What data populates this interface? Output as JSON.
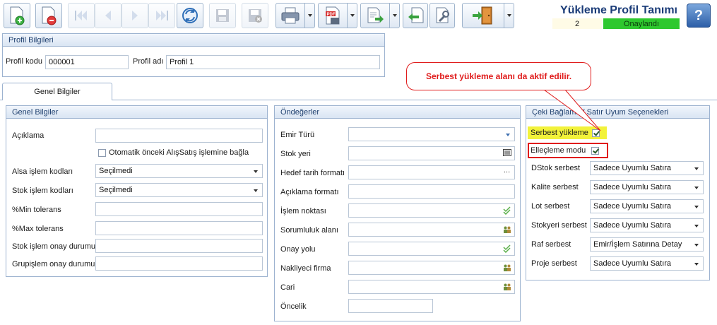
{
  "header": {
    "title": "Yükleme Profil Tanımı",
    "record_count": "2",
    "status": "Onaylandı"
  },
  "profile_info": {
    "title": "Profil Bilgileri",
    "code_label": "Profil kodu",
    "code_value": "000001",
    "name_label": "Profil adı",
    "name_value": "Profil 1"
  },
  "tabs": [
    {
      "label": "Genel Bilgiler"
    }
  ],
  "callout": {
    "text": "Serbest yükleme alanı da aktif edilir."
  },
  "general": {
    "title": "Genel Bilgiler",
    "description_label": "Açıklama",
    "description_value": "",
    "auto_link_label": "Otomatik önceki AlışSatış işlemine bağla",
    "buy_codes_label": "Alsa işlem kodları",
    "buy_codes_value": "Seçilmedi",
    "stock_codes_label": "Stok işlem kodları",
    "stock_codes_value": "Seçilmedi",
    "min_tol_label": "%Min tolerans",
    "min_tol_value": "",
    "max_tol_label": "%Max tolerans",
    "max_tol_value": "",
    "stock_approval_label": "Stok işlem onay durumu",
    "stock_approval_value": "",
    "group_approval_label": "Grupişlem onay durumu",
    "group_approval_value": ""
  },
  "defaults": {
    "title": "Öndeğerler",
    "order_type_label": "Emir Türü",
    "stock_place_label": "Stok yeri",
    "target_date_label": "Hedef tarih formatı",
    "desc_format_label": "Açıklama formatı",
    "process_point_label": "İşlem noktası",
    "resp_area_label": "Sorumluluk alanı",
    "approval_path_label": "Onay yolu",
    "carrier_label": "Nakliyeci firma",
    "account_label": "Cari",
    "priority_label": "Öncelik"
  },
  "options": {
    "title": "Çeki Bağlama / Satır Uyum Seçenekleri",
    "free_load_label": "Serbest yükleme",
    "free_load_checked": true,
    "handling_mode_label": "Elleçleme modu",
    "handling_mode_checked": true,
    "rows": [
      {
        "label": "DStok serbest",
        "value": "Sadece Uyumlu Satıra"
      },
      {
        "label": "Kalite serbest",
        "value": "Sadece Uyumlu Satıra"
      },
      {
        "label": "Lot serbest",
        "value": "Sadece Uyumlu Satıra"
      },
      {
        "label": "Stokyeri serbest",
        "value": "Sadece Uyumlu Satıra"
      },
      {
        "label": "Raf serbest",
        "value": "Emir/İşlem Satırına Detay"
      },
      {
        "label": "Proje serbest",
        "value": "Sadece Uyumlu Satıra"
      }
    ]
  },
  "icons": {
    "new": "new-document-icon",
    "delete": "delete-document-icon",
    "first": "first-record-icon",
    "prev": "previous-record-icon",
    "next": "next-record-icon",
    "last": "last-record-icon",
    "refresh": "refresh-icon",
    "save": "save-icon",
    "cancel": "cancel-save-icon",
    "print": "printer-icon",
    "pdf": "pdf-export-icon",
    "export": "export-icon",
    "import": "import-icon",
    "tools": "tools-icon",
    "exit": "exit-door-icon",
    "help": "help-icon"
  }
}
